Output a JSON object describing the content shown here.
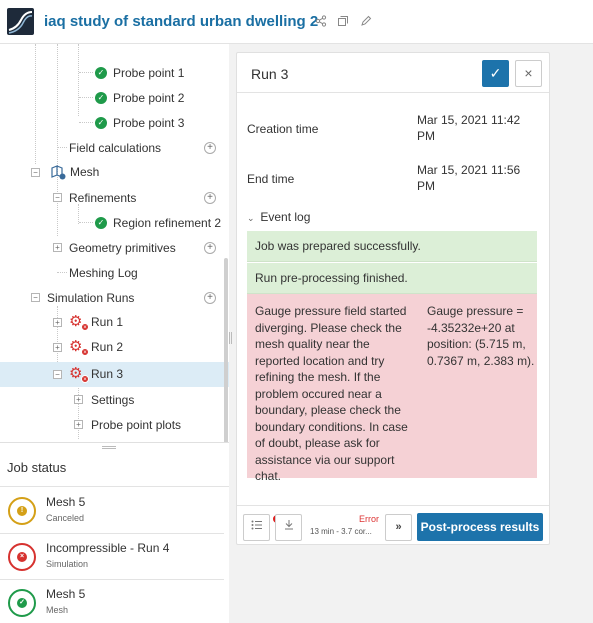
{
  "header": {
    "project_title": "iaq study of standard urban dwelling 2",
    "icons": [
      "share-icon",
      "copy-icon",
      "edit-icon"
    ]
  },
  "tree": {
    "items": [
      {
        "label": "Probe point 1",
        "icon": "check-icon",
        "level": 3
      },
      {
        "label": "Probe point 2",
        "icon": "check-icon",
        "level": 3
      },
      {
        "label": "Probe point 3",
        "icon": "check-icon",
        "level": 3
      },
      {
        "label": "Field calculations",
        "level": 2
      },
      {
        "label": "Mesh",
        "icon": "mesh-icon",
        "level": 1
      },
      {
        "label": "Refinements",
        "level": 2
      },
      {
        "label": "Region refinement 2",
        "icon": "check-icon",
        "level": 3
      },
      {
        "label": "Geometry primitives",
        "level": 2
      },
      {
        "label": "Meshing Log",
        "level": 2
      },
      {
        "label": "Simulation Runs",
        "level": 1
      },
      {
        "label": "Run 1",
        "icon": "gear-error-icon",
        "level": 2
      },
      {
        "label": "Run 2",
        "icon": "gear-error-icon",
        "level": 2
      },
      {
        "label": "Run 3",
        "icon": "gear-error-icon",
        "level": 2,
        "selected": true
      },
      {
        "label": "Settings",
        "level": 3
      },
      {
        "label": "Probe point plots",
        "level": 3
      }
    ]
  },
  "job_status": {
    "title": "Job status",
    "jobs": [
      {
        "name": "Mesh 5",
        "sub": "Canceled",
        "status": "canceled",
        "color": "#d4a017"
      },
      {
        "name": "Incompressible - Run 4",
        "sub": "Simulation",
        "status": "failed",
        "color": "#d6322f"
      },
      {
        "name": "Mesh 5",
        "sub": "Mesh",
        "status": "done",
        "color": "#1f9a4a"
      }
    ]
  },
  "detail": {
    "title": "Run 3",
    "creation_label": "Creation time",
    "creation_value": "Mar 15, 2021 11:42 PM",
    "end_label": "End time",
    "end_value": "Mar 15, 2021 11:56 PM",
    "event_log_label": "Event log",
    "events": {
      "prepared": "Job was prepared successfully.",
      "preprocessing": "Run pre-processing finished.",
      "error_message": "Gauge pressure field started diverging. Please check the mesh quality near the reported location and try refining the mesh. If the problem occured near a boundary, please check the boundary conditions. In case of doubt, please ask for assistance via our support chat.",
      "error_detail": "Gauge pressure = -4.35232e+20 at position: (5.715 m, 0.7367 m, 2.383 m)."
    },
    "footer": {
      "status_label": "Error",
      "status_time": "13 min - 3.7 cor...",
      "post_process_label": "Post-process results"
    }
  },
  "colors": {
    "accent": "#1d73ab",
    "title_blue": "#1a6fa3",
    "success_bg": "#dcefd7",
    "error_bg": "#f5d1d5",
    "error_red": "#d6322f"
  }
}
